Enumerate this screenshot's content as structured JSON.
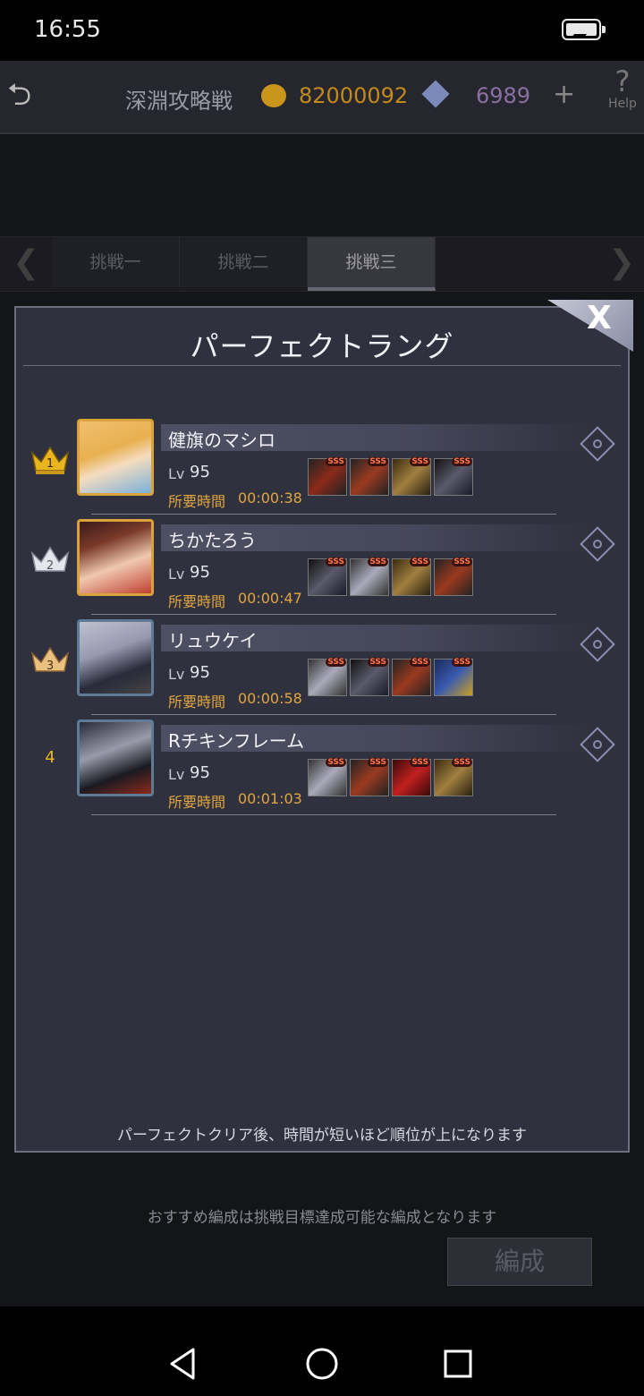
{
  "status": {
    "time": "16:55"
  },
  "header": {
    "title": "深淵攻略戦",
    "coins": "82000092",
    "gems": "6989",
    "plus": "+",
    "help": "Help"
  },
  "tabs": [
    {
      "label": "挑戦一"
    },
    {
      "label": "挑戦二"
    },
    {
      "label": "挑戦三",
      "active": true
    }
  ],
  "background": {
    "edit_button": "編成",
    "note": "おすすめ編成は挑戦目標達成可能な編成となります"
  },
  "modal": {
    "title": "パーフェクトラング",
    "close": "X",
    "footer": "パーフェクトクリア後、時間が短いほど順位が上になります",
    "lv_label": "Lv",
    "time_label": "所要時間",
    "sss": "SSS",
    "entries": [
      {
        "rank": "1",
        "name": "健旗のマシロ",
        "lv": "95",
        "time": "00:00:38"
      },
      {
        "rank": "2",
        "name": "ちかたろう",
        "lv": "95",
        "time": "00:00:47"
      },
      {
        "rank": "3",
        "name": "リュウケイ",
        "lv": "95",
        "time": "00:00:58"
      },
      {
        "rank": "4",
        "name": "Rチキンフレーム",
        "lv": "95",
        "time": "00:01:03"
      }
    ]
  },
  "colors": {
    "accent": "#e0a640",
    "panel": "#323442",
    "text": "#f0f0f4"
  }
}
